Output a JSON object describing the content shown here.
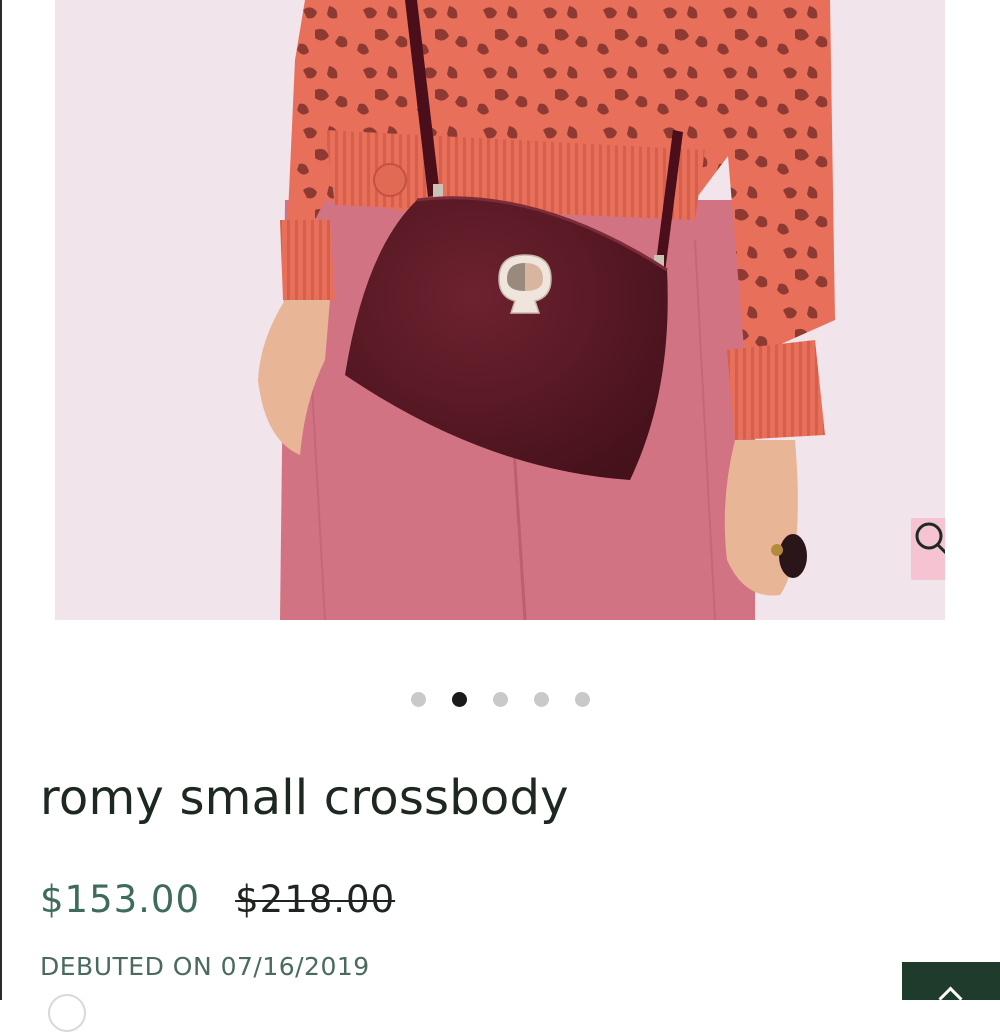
{
  "product": {
    "title": "romy small crossbody",
    "sale_price": "$153.00",
    "original_price": "$218.00",
    "debuted": "DEBUTED ON 07/16/2019"
  },
  "gallery": {
    "image_count": 5,
    "active_index": 1,
    "zoom_icon": "magnifier-icon"
  },
  "colors": {
    "background": "#f1e4ea",
    "sweater": "#e8705a",
    "pants": "#d27384",
    "bag": "#5a1a24",
    "sale_price": "#3f6b5d",
    "title": "#1c2820",
    "zoom_button": "#f6c3d3",
    "corner_button": "#1f3b2c"
  }
}
